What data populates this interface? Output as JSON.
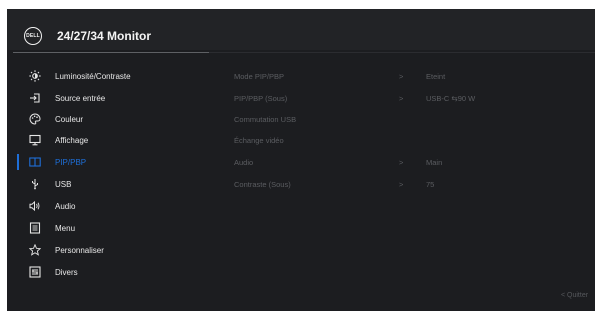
{
  "header": {
    "title": "24/27/34 Monitor",
    "logo_text": "DELL"
  },
  "menu": [
    {
      "label": "Luminosité/Contraste",
      "icon": "brightness-icon",
      "selected": false
    },
    {
      "label": "Source entrée",
      "icon": "input-source-icon",
      "selected": false
    },
    {
      "label": "Couleur",
      "icon": "color-palette-icon",
      "selected": false
    },
    {
      "label": "Affichage",
      "icon": "display-icon",
      "selected": false
    },
    {
      "label": "PIP/PBP",
      "icon": "pip-pbp-icon",
      "selected": true
    },
    {
      "label": "USB",
      "icon": "usb-icon",
      "selected": false
    },
    {
      "label": "Audio",
      "icon": "speaker-icon",
      "selected": false
    },
    {
      "label": "Menu",
      "icon": "menu-icon",
      "selected": false
    },
    {
      "label": "Personnaliser",
      "icon": "star-icon",
      "selected": false
    },
    {
      "label": "Divers",
      "icon": "misc-icon",
      "selected": false
    }
  ],
  "submenu": [
    {
      "name": "Mode PIP/PBP",
      "chevron": ">",
      "value": "Eteint"
    },
    {
      "name": "PIP/PBP (Sous)",
      "chevron": ">",
      "value": "USB-C ⇆90 W"
    },
    {
      "name": "Commutation USB",
      "chevron": "",
      "value": ""
    },
    {
      "name": "Échange vidéo",
      "chevron": "",
      "value": ""
    },
    {
      "name": "Audio",
      "chevron": ">",
      "value": "Main"
    },
    {
      "name": "Contraste (Sous)",
      "chevron": ">",
      "value": "75"
    }
  ],
  "footer": {
    "quit_label": "< Quitter"
  },
  "colors": {
    "accent": "#1e6fd9",
    "background": "#1c1d20",
    "text": "#e8e8e8",
    "disabled_text": "#5b5d61"
  }
}
